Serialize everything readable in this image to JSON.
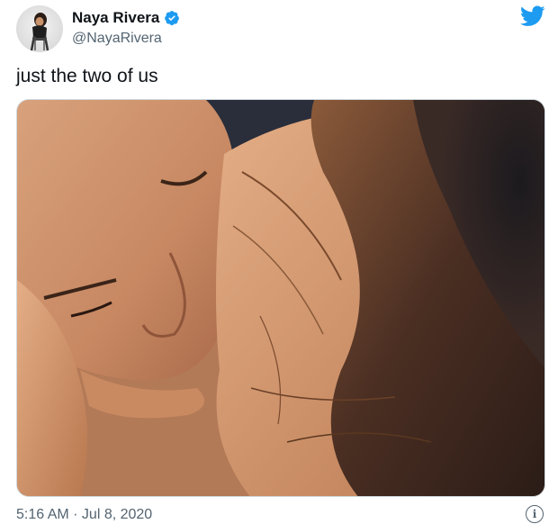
{
  "author": {
    "name": "Naya Rivera",
    "handle": "@NayaRivera",
    "verified": true,
    "avatar_icon": "profile-photo"
  },
  "tweet": {
    "text": "just the two of us",
    "media_description_icon": "photo",
    "timestamp": "5:16 AM · Jul 8, 2020",
    "info_glyph": "i"
  },
  "colors": {
    "brand": "#1d9bf0",
    "text": "#0f1419",
    "secondary_text": "#536471",
    "border": "#cfd9de"
  }
}
